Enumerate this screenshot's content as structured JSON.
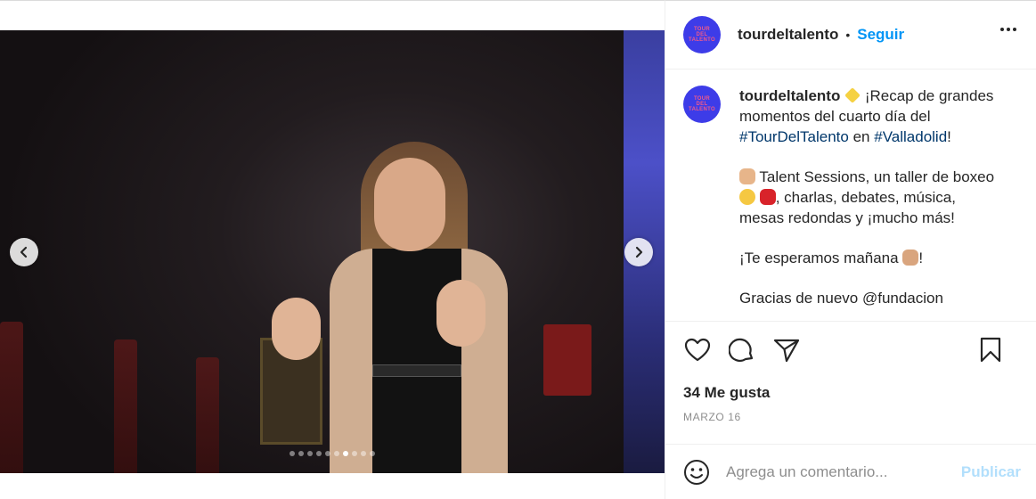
{
  "post": {
    "carousel": {
      "total_slides": 10,
      "active_index": 6
    },
    "header": {
      "avatar_text": [
        "TOUR",
        "DEL",
        "TALENTO"
      ],
      "username": "tourdeltalento",
      "separator": "•",
      "follow_label": "Seguir"
    },
    "caption": {
      "username": "tourdeltalento",
      "para1_text": "¡Recap de grandes momentos del cuarto día del",
      "hashtag1": "#TourDelTalento",
      "para1_mid": "en",
      "hashtag2": "#Valladolid",
      "para1_end": "!",
      "para2_start": "Talent Sessions, un taller de boxeo",
      "para2_end": ", charlas, debates, música, mesas redondas y ¡mucho más!",
      "para3_start": "¡Te esperamos mañana",
      "para3_end": "!",
      "para4": "Gracias de nuevo @fundacion"
    },
    "actions": {
      "likes_text": "34 Me gusta",
      "date_text": "MARZO 16"
    },
    "comment": {
      "placeholder": "Agrega un comentario...",
      "publish_label": "Publicar"
    },
    "colors": {
      "accent": "#0095f6",
      "publish_disabled": "#b2dffc",
      "avatar_bg": "#3d3ce8",
      "avatar_text": "#f05a8a",
      "hashtag": "#00376b"
    },
    "icons": [
      "heart-icon",
      "comment-icon",
      "share-icon",
      "bookmark-icon",
      "emoji-icon",
      "chevron-left-icon",
      "chevron-right-icon",
      "more-icon"
    ]
  }
}
